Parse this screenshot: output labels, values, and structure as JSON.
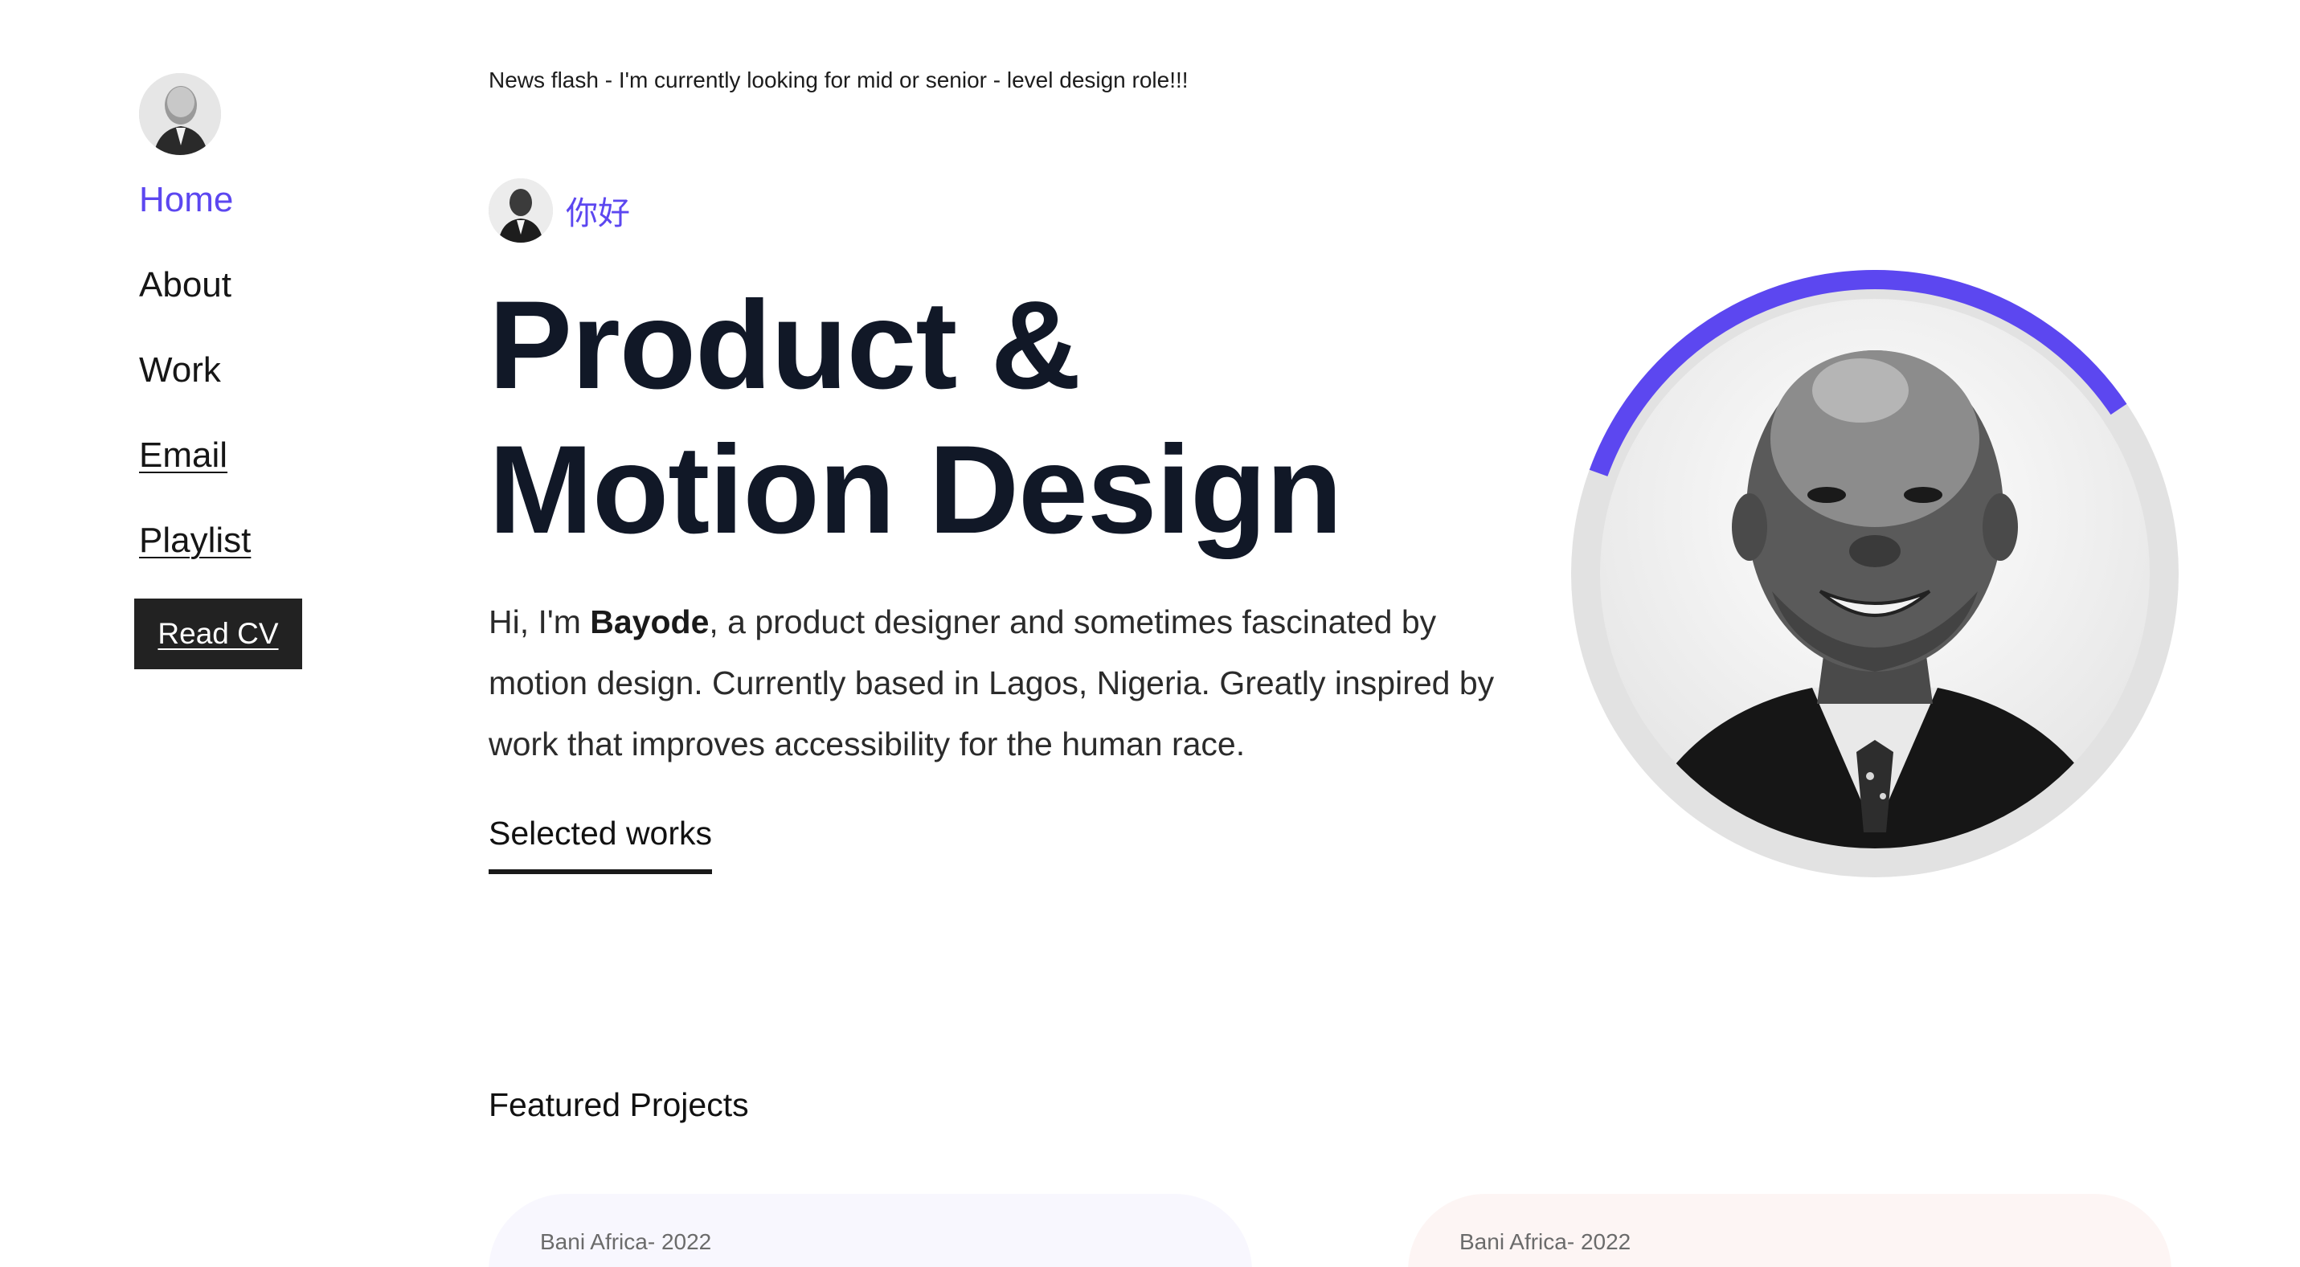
{
  "news_flash": "News flash - I'm currently looking for mid or senior - level design role!!!",
  "sidebar": {
    "items": [
      {
        "label": "Home"
      },
      {
        "label": "About"
      },
      {
        "label": "Work"
      },
      {
        "label": "Email"
      },
      {
        "label": "Playlist"
      }
    ],
    "cv_label": "Read CV"
  },
  "hero": {
    "greeting": "你好",
    "title_line1": "Product &",
    "title_line2": "Motion Design",
    "intro_before": "Hi, I'm ",
    "intro_name": "Bayode",
    "intro_after": ", a product designer and sometimes fascinated by motion design. Currently based in Lagos, Nigeria. Greatly inspired by work that improves accessibility for the human race.",
    "selected_works": "Selected works"
  },
  "portrait": {
    "progress": 0.35,
    "accent_color": "#5c47f0",
    "track_color": "#e2e2e2"
  },
  "featured": {
    "title": "Featured Projects",
    "cards": [
      {
        "label": "Bani Africa- 2022"
      },
      {
        "label": "Bani Africa- 2022"
      }
    ]
  },
  "colors": {
    "accent": "#5c47f0",
    "heading": "#111827",
    "button_bg": "#222222"
  }
}
